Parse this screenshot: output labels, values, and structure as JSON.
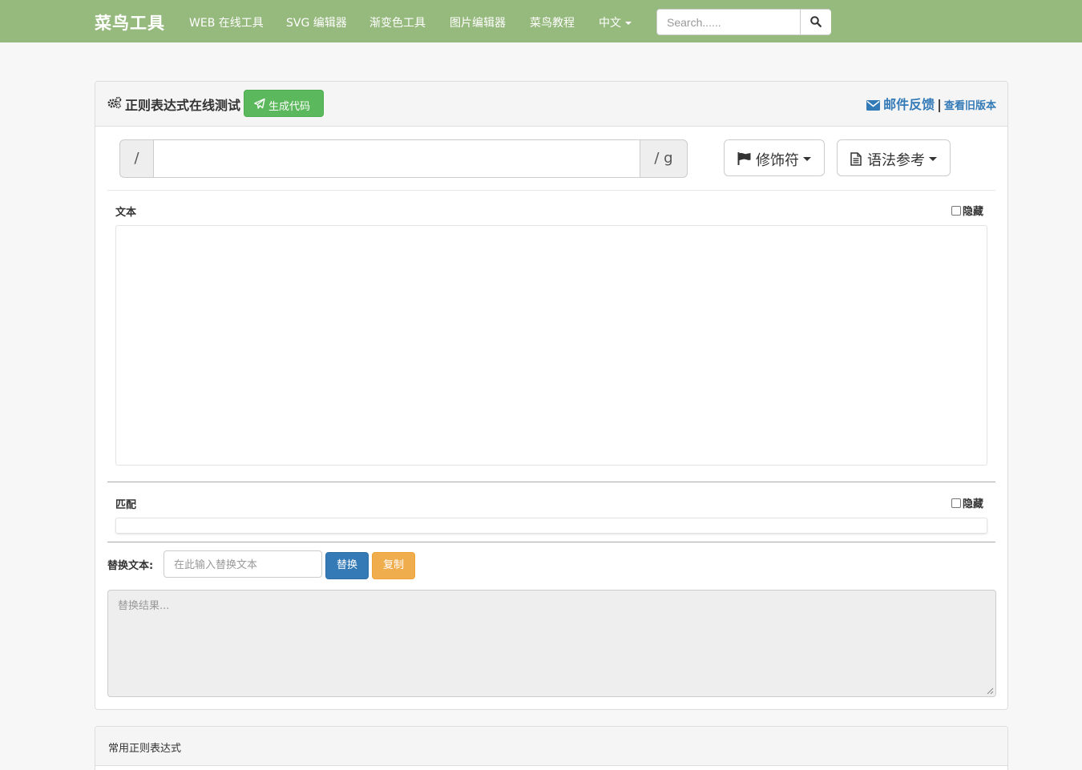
{
  "navbar": {
    "brand": "菜鸟工具",
    "links": [
      "WEB 在线工具",
      "SVG 编辑器",
      "渐变色工具",
      "图片编辑器",
      "菜鸟教程",
      "中文"
    ],
    "search_placeholder": "Search......",
    "bg_color": "#96b97d"
  },
  "main": {
    "title": "正则表达式在线测试",
    "generate_code_label": "生成代码",
    "feedback_label": "邮件反馈",
    "separator": "|",
    "old_version_label": "查看旧版本",
    "regex_prefix": "/",
    "regex_suffix": "/ g",
    "regex_value": "",
    "modifiers_label": "修饰符",
    "syntax_label": "语法参考",
    "text_label": "文本",
    "hide_label": "隐藏",
    "match_label": "匹配",
    "replace_label": "替换文本:",
    "replace_placeholder": "在此输入替换文本",
    "replace_button": "替换",
    "copy_button": "复制",
    "result_placeholder": "替换结果..."
  },
  "common": {
    "title": "常用正则表达式"
  },
  "icons": [
    "cogs-icon",
    "paper-plane-icon",
    "envelope-icon",
    "search-icon",
    "flag-icon",
    "file-text-icon",
    "caret-down-icon"
  ]
}
